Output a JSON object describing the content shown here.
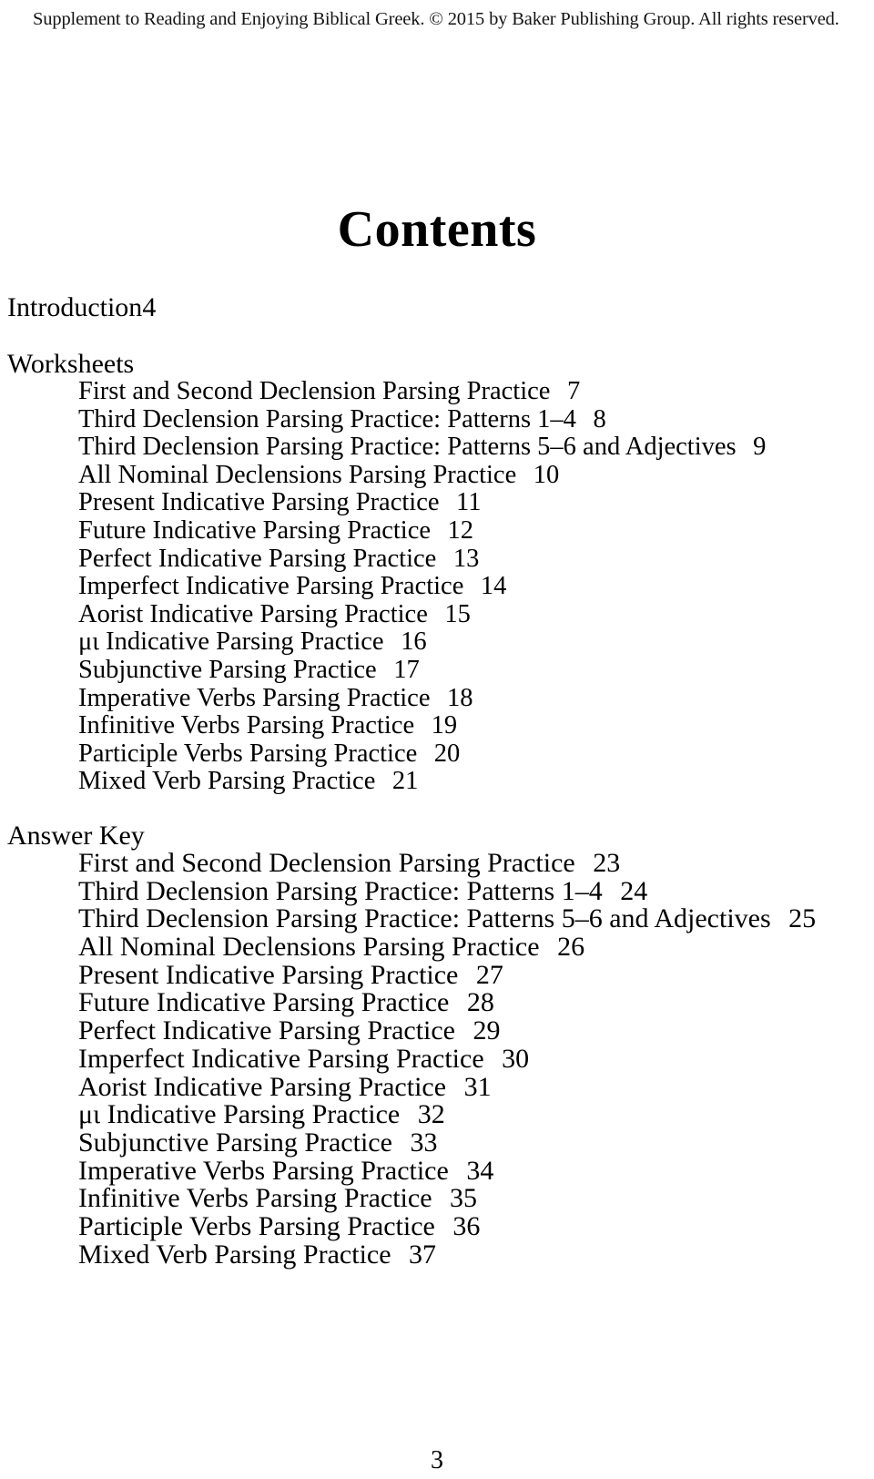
{
  "header": {
    "copyright_line": "Supplement to Reading and Enjoying Biblical Greek. © 2015 by Baker Publishing Group. All rights reserved."
  },
  "title": "Contents",
  "front_matter": [
    {
      "title": "Introduction",
      "page": "4"
    }
  ],
  "sections": [
    {
      "heading": "Worksheets",
      "entries": [
        {
          "title": "First and Second Declension Parsing Practice",
          "page": "7"
        },
        {
          "title": "Third Declension Parsing Practice: Patterns 1–4",
          "page": "8"
        },
        {
          "title": "Third Declension Parsing Practice: Patterns 5–6 and Adjectives",
          "page": "9"
        },
        {
          "title": "All Nominal Declensions Parsing Practice",
          "page": "10"
        },
        {
          "title": "Present Indicative Parsing Practice",
          "page": "11"
        },
        {
          "title": "Future Indicative Parsing Practice",
          "page": "12"
        },
        {
          "title": "Perfect Indicative Parsing Practice",
          "page": "13"
        },
        {
          "title": "Imperfect Indicative Parsing Practice",
          "page": "14"
        },
        {
          "title": "Aorist Indicative Parsing Practice",
          "page": "15"
        },
        {
          "title": "μι Indicative Parsing Practice",
          "page": "16"
        },
        {
          "title": "Subjunctive Parsing Practice",
          "page": "17"
        },
        {
          "title": "Imperative Verbs Parsing Practice",
          "page": "18"
        },
        {
          "title": "Infinitive Verbs Parsing Practice",
          "page": "19"
        },
        {
          "title": "Participle Verbs Parsing Practice",
          "page": "20"
        },
        {
          "title": "Mixed Verb Parsing Practice",
          "page": "21"
        }
      ]
    },
    {
      "heading": "Answer Key",
      "entries": [
        {
          "title": "First and Second Declension Parsing Practice",
          "page": "23"
        },
        {
          "title": "Third Declension Parsing Practice: Patterns 1–4",
          "page": "24"
        },
        {
          "title": "Third Declension Parsing Practice: Patterns 5–6 and Adjectives",
          "page": "25"
        },
        {
          "title": "All Nominal Declensions Parsing Practice",
          "page": "26"
        },
        {
          "title": "Present Indicative Parsing Practice",
          "page": "27"
        },
        {
          "title": "Future Indicative Parsing Practice",
          "page": "28"
        },
        {
          "title": "Perfect Indicative Parsing Practice",
          "page": "29"
        },
        {
          "title": "Imperfect Indicative Parsing Practice",
          "page": "30"
        },
        {
          "title": "Aorist Indicative Parsing Practice",
          "page": "31"
        },
        {
          "title": "μι Indicative Parsing Practice",
          "page": "32"
        },
        {
          "title": "Subjunctive Parsing Practice",
          "page": "33"
        },
        {
          "title": "Imperative Verbs Parsing Practice",
          "page": "34"
        },
        {
          "title": "Infinitive Verbs Parsing Practice",
          "page": "35"
        },
        {
          "title": "Participle Verbs Parsing Practice",
          "page": "36"
        },
        {
          "title": "Mixed Verb Parsing Practice",
          "page": "37"
        }
      ]
    }
  ],
  "folio": "3"
}
